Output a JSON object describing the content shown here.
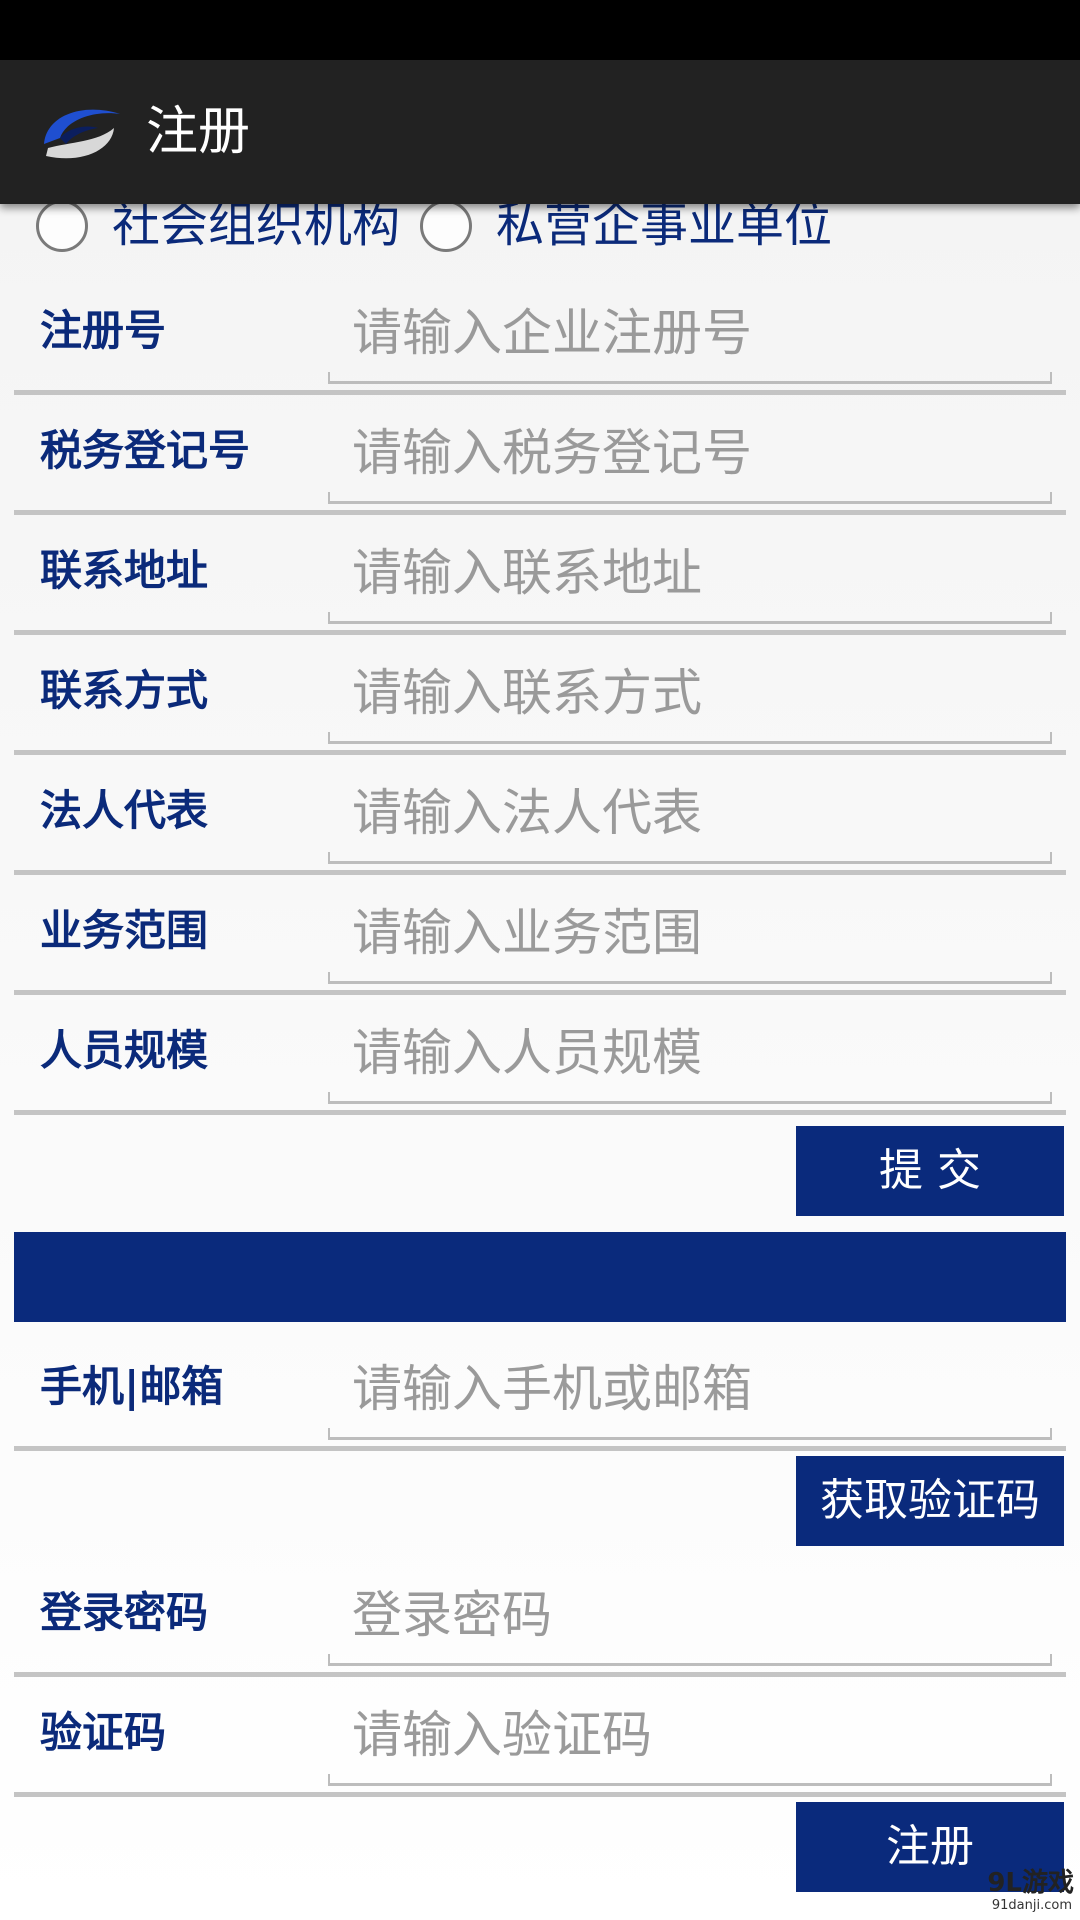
{
  "app": {
    "title": "注册",
    "logo": "app-logo"
  },
  "radios": [
    {
      "label": "社会组织机构",
      "checked": false
    },
    {
      "label": "私营企事业单位",
      "checked": false
    }
  ],
  "fields": [
    {
      "label": "注册号",
      "placeholder": "请输入企业注册号"
    },
    {
      "label": "税务登记号",
      "placeholder": "请输入税务登记号"
    },
    {
      "label": "联系地址",
      "placeholder": "请输入联系地址"
    },
    {
      "label": "联系方式",
      "placeholder": "请输入联系方式"
    },
    {
      "label": "法人代表",
      "placeholder": "请输入法人代表"
    },
    {
      "label": "业务范围",
      "placeholder": "请输入业务范围"
    },
    {
      "label": "人员规模",
      "placeholder": "请输入人员规模"
    }
  ],
  "submit_label": "提 交",
  "account": {
    "contact": {
      "label": "手机|邮箱",
      "placeholder": "请输入手机或邮箱"
    },
    "get_code_label": "获取验证码",
    "password": {
      "label": "登录密码",
      "placeholder": "登录密码"
    },
    "code": {
      "label": "验证码",
      "placeholder": "请输入验证码"
    },
    "register_label": "注册"
  },
  "watermark": {
    "main": "9L游戏",
    "sub": "91danji.com"
  },
  "colors": {
    "primary": "#0a2a7c",
    "action_bar": "#222222",
    "label": "#0b2a7a"
  }
}
